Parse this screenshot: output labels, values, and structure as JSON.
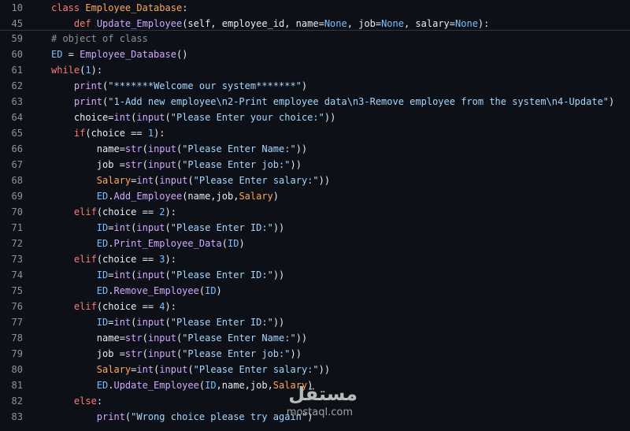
{
  "sticky_lines": [
    {
      "num": "10",
      "tokens": [
        [
          "k",
          "class "
        ],
        [
          "o",
          "Employee_Database"
        ],
        [
          "",
          ":"
        ]
      ]
    },
    {
      "num": "45",
      "tokens": [
        [
          "",
          "    "
        ],
        [
          "k",
          "def "
        ],
        [
          "f",
          "Update_Employee"
        ],
        [
          "",
          "(self, employee_id, name="
        ],
        [
          "c",
          "None"
        ],
        [
          "",
          ", job="
        ],
        [
          "c",
          "None"
        ],
        [
          "",
          ", salary="
        ],
        [
          "c",
          "None"
        ],
        [
          "",
          "):"
        ]
      ]
    }
  ],
  "lines": [
    {
      "num": "59",
      "tokens": [
        [
          "cm",
          "# object of class"
        ]
      ]
    },
    {
      "num": "60",
      "tokens": [
        [
          "c",
          "ED"
        ],
        [
          "",
          " = "
        ],
        [
          "f",
          "Employee_Database"
        ],
        [
          "",
          "()"
        ]
      ]
    },
    {
      "num": "61",
      "tokens": [
        [
          "k",
          "while"
        ],
        [
          "",
          "("
        ],
        [
          "c",
          "1"
        ],
        [
          "",
          "):"
        ]
      ]
    },
    {
      "num": "62",
      "tokens": [
        [
          "",
          "    "
        ],
        [
          "f",
          "print"
        ],
        [
          "",
          "("
        ],
        [
          "s",
          "\"*******Welcome our system*******\""
        ],
        [
          "",
          ")"
        ]
      ]
    },
    {
      "num": "63",
      "tokens": [
        [
          "",
          "    "
        ],
        [
          "f",
          "print"
        ],
        [
          "",
          "("
        ],
        [
          "s",
          "\"1-Add new employee\\n2-Print employee data\\n3-Remove employee from the system\\n4-Update\""
        ],
        [
          "",
          ")"
        ]
      ]
    },
    {
      "num": "64",
      "tokens": [
        [
          "",
          "    choice="
        ],
        [
          "f",
          "int"
        ],
        [
          "",
          "("
        ],
        [
          "f",
          "input"
        ],
        [
          "",
          "("
        ],
        [
          "s",
          "\"Please Enter your choice:\""
        ],
        [
          "",
          "))"
        ]
      ]
    },
    {
      "num": "65",
      "tokens": [
        [
          "",
          "    "
        ],
        [
          "k",
          "if"
        ],
        [
          "",
          "(choice == "
        ],
        [
          "c",
          "1"
        ],
        [
          "",
          "):"
        ]
      ]
    },
    {
      "num": "66",
      "tokens": [
        [
          "",
          "        name="
        ],
        [
          "f",
          "str"
        ],
        [
          "",
          "("
        ],
        [
          "f",
          "input"
        ],
        [
          "",
          "("
        ],
        [
          "s",
          "\"Please Enter Name:\""
        ],
        [
          "",
          "))"
        ]
      ]
    },
    {
      "num": "67",
      "tokens": [
        [
          "",
          "        job ="
        ],
        [
          "f",
          "str"
        ],
        [
          "",
          "("
        ],
        [
          "f",
          "input"
        ],
        [
          "",
          "("
        ],
        [
          "s",
          "\"Please Enter job:\""
        ],
        [
          "",
          "))"
        ]
      ]
    },
    {
      "num": "68",
      "tokens": [
        [
          "",
          "        "
        ],
        [
          "o",
          "Salary"
        ],
        [
          "",
          "="
        ],
        [
          "f",
          "int"
        ],
        [
          "",
          "("
        ],
        [
          "f",
          "input"
        ],
        [
          "",
          "("
        ],
        [
          "s",
          "\"Please Enter salary:\""
        ],
        [
          "",
          "))"
        ]
      ]
    },
    {
      "num": "69",
      "tokens": [
        [
          "",
          "        "
        ],
        [
          "c",
          "ED"
        ],
        [
          "",
          "."
        ],
        [
          "f",
          "Add_Employee"
        ],
        [
          "",
          "(name,job,"
        ],
        [
          "o",
          "Salary"
        ],
        [
          "",
          ")"
        ]
      ]
    },
    {
      "num": "70",
      "tokens": [
        [
          "",
          "    "
        ],
        [
          "k",
          "elif"
        ],
        [
          "",
          "(choice == "
        ],
        [
          "c",
          "2"
        ],
        [
          "",
          "):"
        ]
      ]
    },
    {
      "num": "71",
      "tokens": [
        [
          "",
          "        "
        ],
        [
          "c",
          "ID"
        ],
        [
          "",
          "="
        ],
        [
          "f",
          "int"
        ],
        [
          "",
          "("
        ],
        [
          "f",
          "input"
        ],
        [
          "",
          "("
        ],
        [
          "s",
          "\"Please Enter ID:\""
        ],
        [
          "",
          "))"
        ]
      ]
    },
    {
      "num": "72",
      "tokens": [
        [
          "",
          "        "
        ],
        [
          "c",
          "ED"
        ],
        [
          "",
          "."
        ],
        [
          "f",
          "Print_Employee_Data"
        ],
        [
          "",
          "("
        ],
        [
          "c",
          "ID"
        ],
        [
          "",
          ")"
        ]
      ]
    },
    {
      "num": "73",
      "tokens": [
        [
          "",
          "    "
        ],
        [
          "k",
          "elif"
        ],
        [
          "",
          "(choice == "
        ],
        [
          "c",
          "3"
        ],
        [
          "",
          "):"
        ]
      ]
    },
    {
      "num": "74",
      "tokens": [
        [
          "",
          "        "
        ],
        [
          "c",
          "ID"
        ],
        [
          "",
          "="
        ],
        [
          "f",
          "int"
        ],
        [
          "",
          "("
        ],
        [
          "f",
          "input"
        ],
        [
          "",
          "("
        ],
        [
          "s",
          "\"Please Enter ID:\""
        ],
        [
          "",
          "))"
        ]
      ]
    },
    {
      "num": "75",
      "tokens": [
        [
          "",
          "        "
        ],
        [
          "c",
          "ED"
        ],
        [
          "",
          "."
        ],
        [
          "f",
          "Remove_Employee"
        ],
        [
          "",
          "("
        ],
        [
          "c",
          "ID"
        ],
        [
          "",
          ")"
        ]
      ]
    },
    {
      "num": "76",
      "tokens": [
        [
          "",
          "    "
        ],
        [
          "k",
          "elif"
        ],
        [
          "",
          "(choice == "
        ],
        [
          "c",
          "4"
        ],
        [
          "",
          "):"
        ]
      ]
    },
    {
      "num": "77",
      "tokens": [
        [
          "",
          "        "
        ],
        [
          "c",
          "ID"
        ],
        [
          "",
          "="
        ],
        [
          "f",
          "int"
        ],
        [
          "",
          "("
        ],
        [
          "f",
          "input"
        ],
        [
          "",
          "("
        ],
        [
          "s",
          "\"Please Enter ID:\""
        ],
        [
          "",
          "))"
        ]
      ]
    },
    {
      "num": "78",
      "tokens": [
        [
          "",
          "        name="
        ],
        [
          "f",
          "str"
        ],
        [
          "",
          "("
        ],
        [
          "f",
          "input"
        ],
        [
          "",
          "("
        ],
        [
          "s",
          "\"Please Enter Name:\""
        ],
        [
          "",
          "))"
        ]
      ]
    },
    {
      "num": "79",
      "tokens": [
        [
          "",
          "        job ="
        ],
        [
          "f",
          "str"
        ],
        [
          "",
          "("
        ],
        [
          "f",
          "input"
        ],
        [
          "",
          "("
        ],
        [
          "s",
          "\"Please Enter job:\""
        ],
        [
          "",
          "))"
        ]
      ]
    },
    {
      "num": "80",
      "tokens": [
        [
          "",
          "        "
        ],
        [
          "o",
          "Salary"
        ],
        [
          "",
          "="
        ],
        [
          "f",
          "int"
        ],
        [
          "",
          "("
        ],
        [
          "f",
          "input"
        ],
        [
          "",
          "("
        ],
        [
          "s",
          "\"Please Enter salary:\""
        ],
        [
          "",
          "))"
        ]
      ]
    },
    {
      "num": "81",
      "tokens": [
        [
          "",
          "        "
        ],
        [
          "c",
          "ED"
        ],
        [
          "",
          "."
        ],
        [
          "f",
          "Update_Employee"
        ],
        [
          "",
          "("
        ],
        [
          "c",
          "ID"
        ],
        [
          "",
          ",name,job,"
        ],
        [
          "o",
          "Salary"
        ],
        [
          "",
          ")"
        ]
      ]
    },
    {
      "num": "82",
      "tokens": [
        [
          "",
          "    "
        ],
        [
          "k",
          "else"
        ],
        [
          "",
          ":"
        ]
      ]
    },
    {
      "num": "83",
      "tokens": [
        [
          "",
          "        "
        ],
        [
          "f",
          "print"
        ],
        [
          "",
          "("
        ],
        [
          "s",
          "\"Wrong choice please try again\""
        ],
        [
          "",
          ")"
        ]
      ]
    }
  ],
  "watermark": {
    "arabic": "مستقل",
    "latin": "mostaql.com"
  },
  "colors": {
    "background": "#0d1117",
    "keyword": "#ff7b72",
    "function": "#d2a8ff",
    "constant": "#79c0ff",
    "string": "#a5d6ff",
    "class_name": "#ffa657",
    "comment": "#8b949e"
  }
}
